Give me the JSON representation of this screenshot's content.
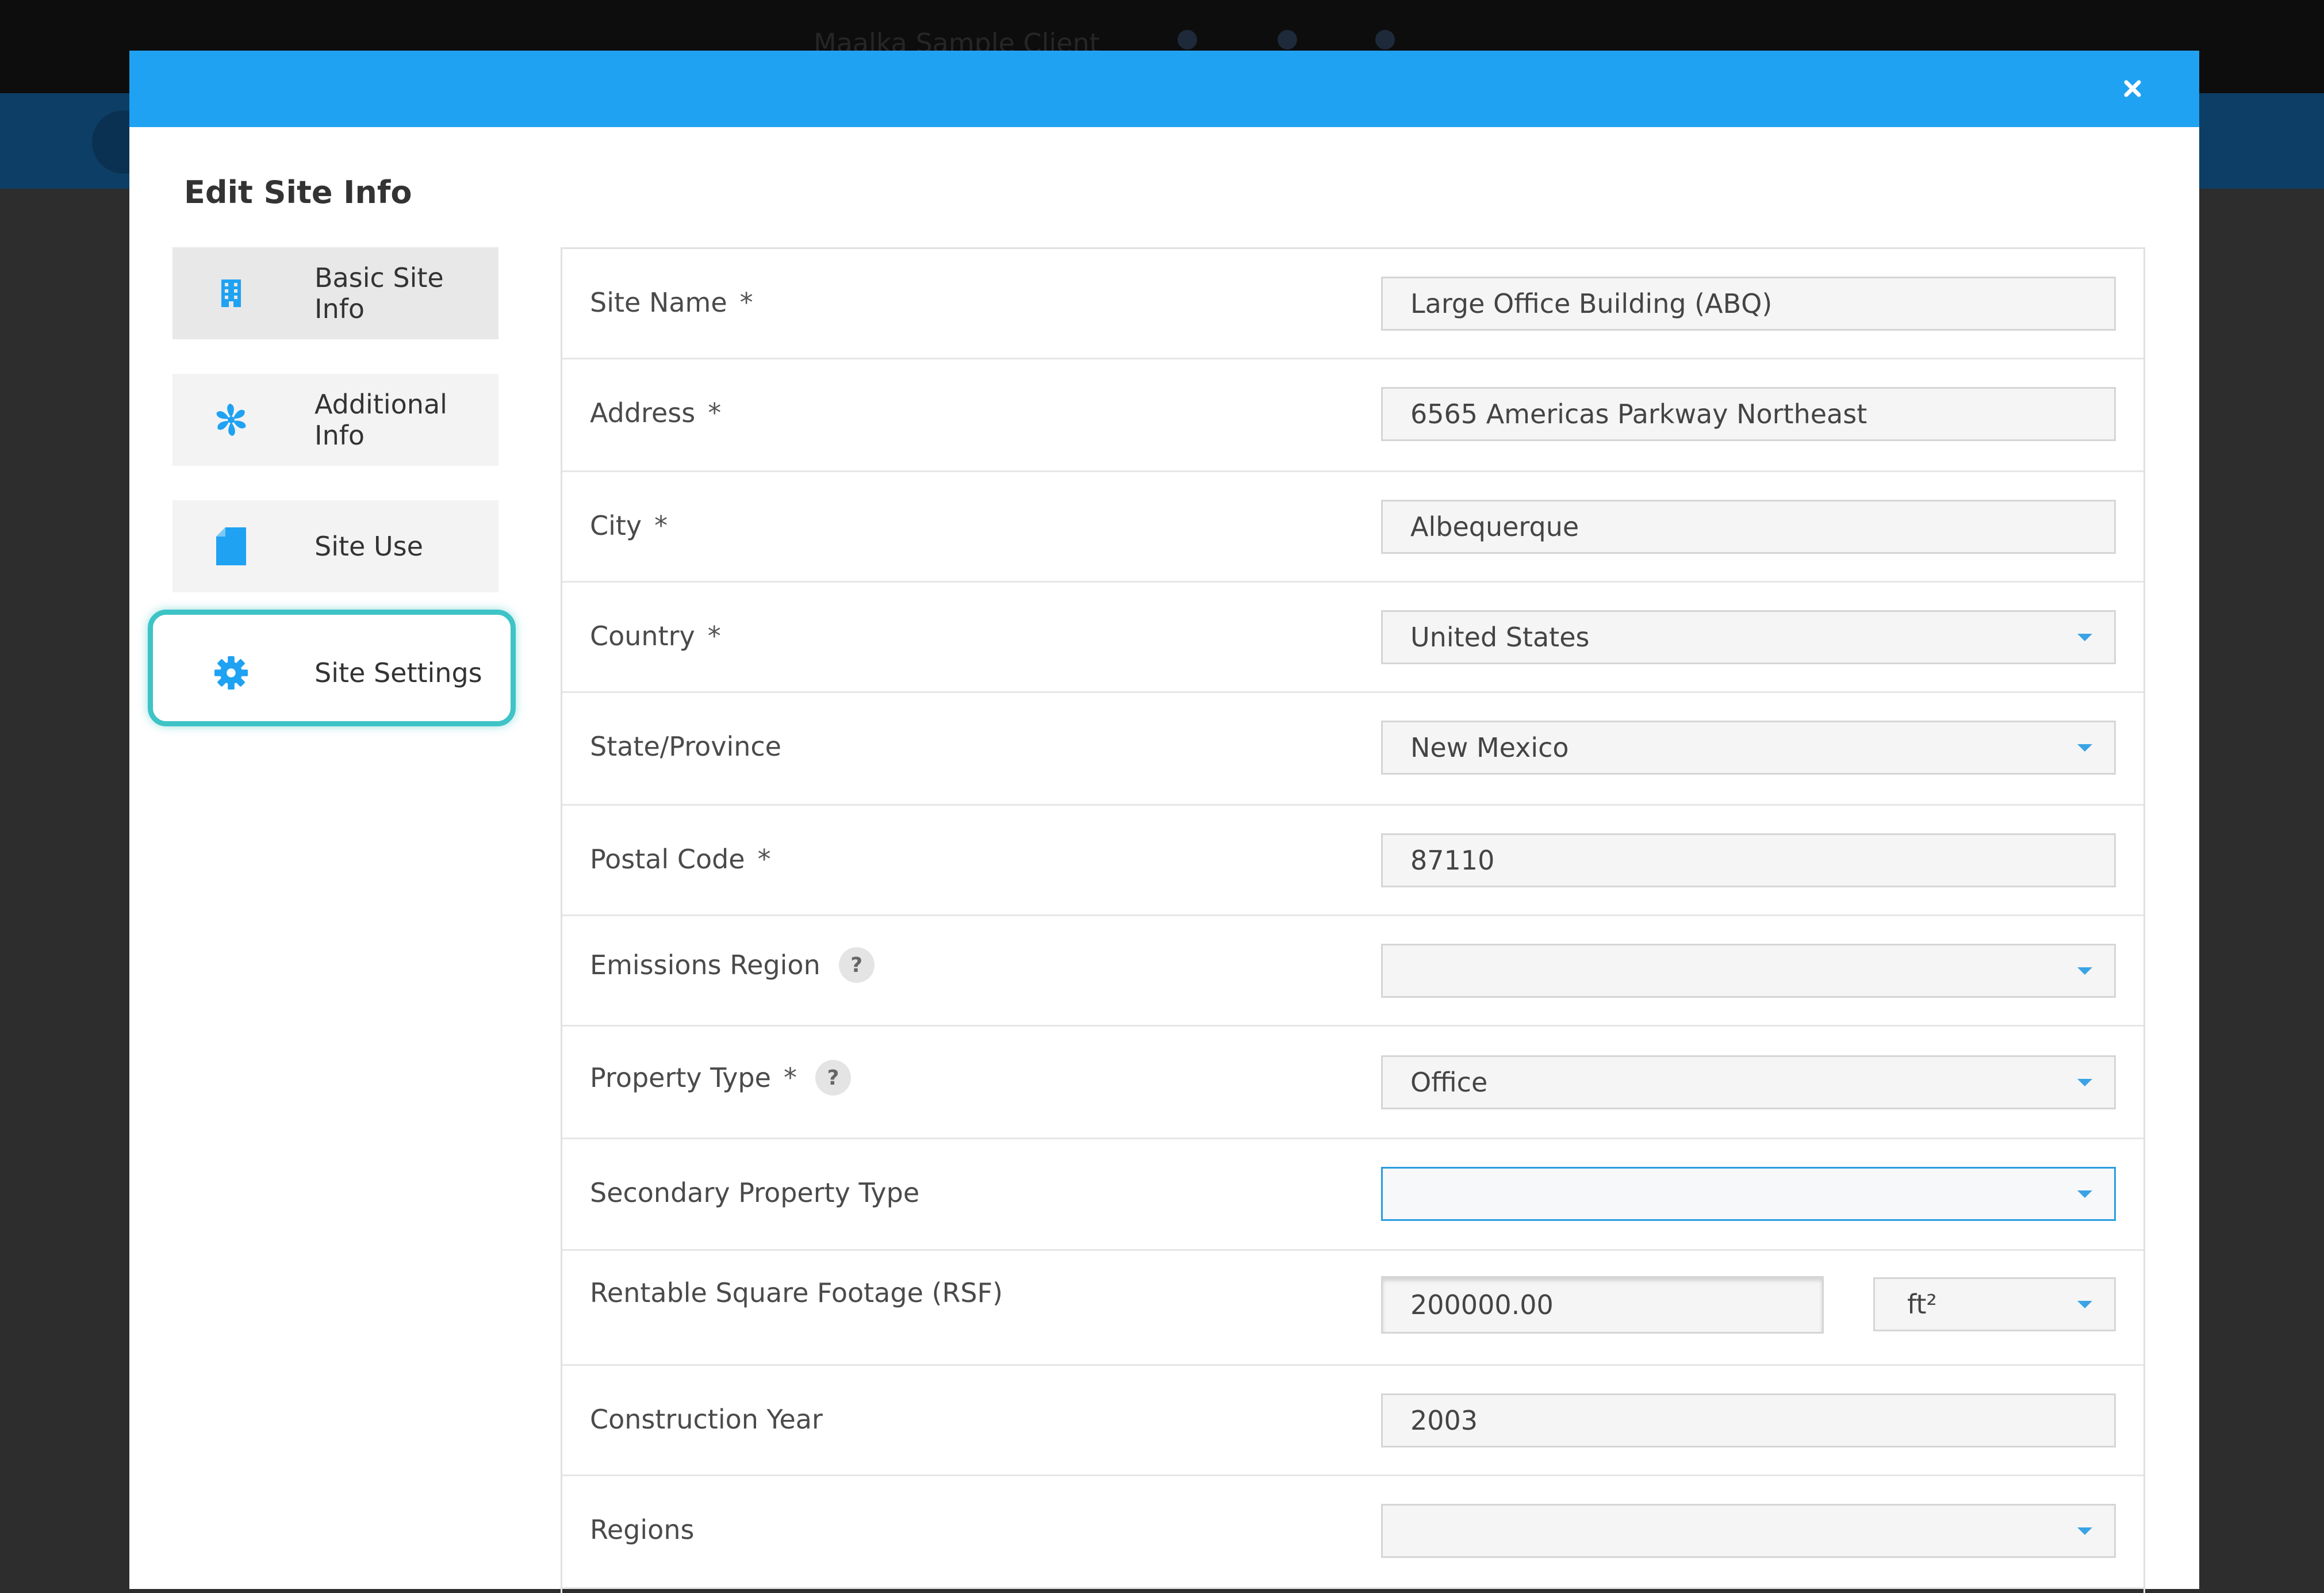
{
  "background": {
    "client_name": "Maalka Sample Client"
  },
  "modal": {
    "title": "Edit Site Info",
    "close_icon": "close-icon",
    "header_color": "#1fa2f2",
    "highlight_color": "#3ec3c6"
  },
  "sidebar": {
    "items": [
      {
        "label": "Basic Site Info",
        "icon": "building-icon",
        "active": true
      },
      {
        "label": "Additional Info",
        "icon": "fan-icon",
        "active": false
      },
      {
        "label": "Site Use",
        "icon": "document-icon",
        "active": false
      },
      {
        "label": "Site Settings",
        "icon": "gear-icon",
        "active": false,
        "highlighted": true
      }
    ]
  },
  "form": {
    "required_mark": "*",
    "help_mark": "?",
    "fields": {
      "site_name": {
        "label": "Site Name",
        "value": "Large Office Building (ABQ)",
        "required": true
      },
      "address": {
        "label": "Address",
        "value": "6565 Americas Parkway Northeast",
        "required": true
      },
      "city": {
        "label": "City",
        "value": "Albequerque",
        "required": true
      },
      "country": {
        "label": "Country",
        "value": "United States",
        "required": true,
        "type": "select"
      },
      "state": {
        "label": "State/Province",
        "value": "New Mexico",
        "type": "select"
      },
      "postal_code": {
        "label": "Postal Code",
        "value": "87110",
        "required": true
      },
      "emissions_region": {
        "label": "Emissions Region",
        "value": "",
        "type": "select",
        "help": true
      },
      "property_type": {
        "label": "Property Type",
        "value": "Office",
        "required": true,
        "type": "select",
        "help": true
      },
      "secondary_property_type": {
        "label": "Secondary Property Type",
        "value": "",
        "type": "select",
        "focused": true
      },
      "rsf": {
        "label": "Rentable Square Footage (RSF)",
        "value": "200000.00",
        "unit": "ft²",
        "type": "number-with-unit"
      },
      "construction_year": {
        "label": "Construction Year",
        "value": "2003"
      },
      "regions": {
        "label": "Regions",
        "value": "",
        "type": "select"
      }
    }
  }
}
